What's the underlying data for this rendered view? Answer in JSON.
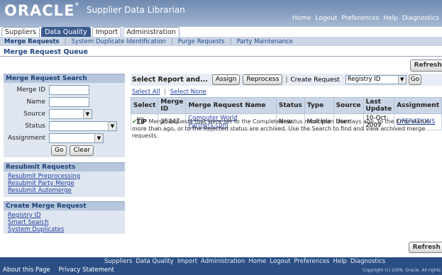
{
  "header": {
    "logo": "ORACLE",
    "app_title": "Supplier Data Librarian",
    "global_links": [
      "Home",
      "Logout",
      "Preferences",
      "Help",
      "Diagnostics"
    ]
  },
  "tabs": [
    {
      "label": "Suppliers",
      "active": false
    },
    {
      "label": "Data Quality",
      "active": true
    },
    {
      "label": "Import",
      "active": false
    },
    {
      "label": "Administration",
      "active": false
    }
  ],
  "subtabs": [
    "Merge Requests",
    "System Duplicate Identification",
    "Purge Requests",
    "Party Maintenance"
  ],
  "page_title": "Merge Request Queue",
  "refresh_label": "Refresh S",
  "search": {
    "title": "Merge Request Search",
    "merge_id_label": "Merge ID",
    "name_label": "Name",
    "source_label": "Source",
    "status_label": "Status",
    "assignment_label": "Assignment",
    "go": "Go",
    "clear": "Clear"
  },
  "resubmit": {
    "title": "Resubmit Requests",
    "links": [
      "Resubmit Preprocessing",
      "Resubmit Party Merge",
      "Resubmit Automerge"
    ]
  },
  "create": {
    "title": "Create Merge Request",
    "links": [
      "Registry ID",
      "Smart Search",
      "System Duplicates"
    ]
  },
  "actions": {
    "select_label": "Select Report and...",
    "assign": "Assign",
    "reprocess": "Reprocess",
    "create_label": "Create Request",
    "create_value": "Registry ID",
    "go": "Go"
  },
  "select_all": "Select All",
  "select_none": "Select None",
  "table": {
    "columns": [
      "Select",
      "Merge ID",
      "Merge Request Name",
      "Status",
      "Type",
      "Source",
      "Last Update",
      "Assignment"
    ],
    "rows": [
      {
        "merge_id": "25247",
        "name": "Computer World Partners.com",
        "status": "New",
        "type": "Multiple",
        "source": "User",
        "last_update": "10-Oct-2009",
        "assignment": "OPERATIONS"
      }
    ]
  },
  "tip": {
    "label": "TIP",
    "text": "Merge requests that were set to the Completed status more than five days ago, to the Error status more than ago, or to the Rejected status are archived. Use the Search to find and view archived merge requests."
  },
  "footer": {
    "links": [
      "Suppliers",
      "Data Quality",
      "Import",
      "Administration",
      "Home",
      "Logout",
      "Preferences",
      "Help",
      "Diagnostics"
    ],
    "about": "About this Page",
    "privacy": "Privacy Statement",
    "copyright": "Copyright (c) 2006, Oracle. All rights"
  }
}
